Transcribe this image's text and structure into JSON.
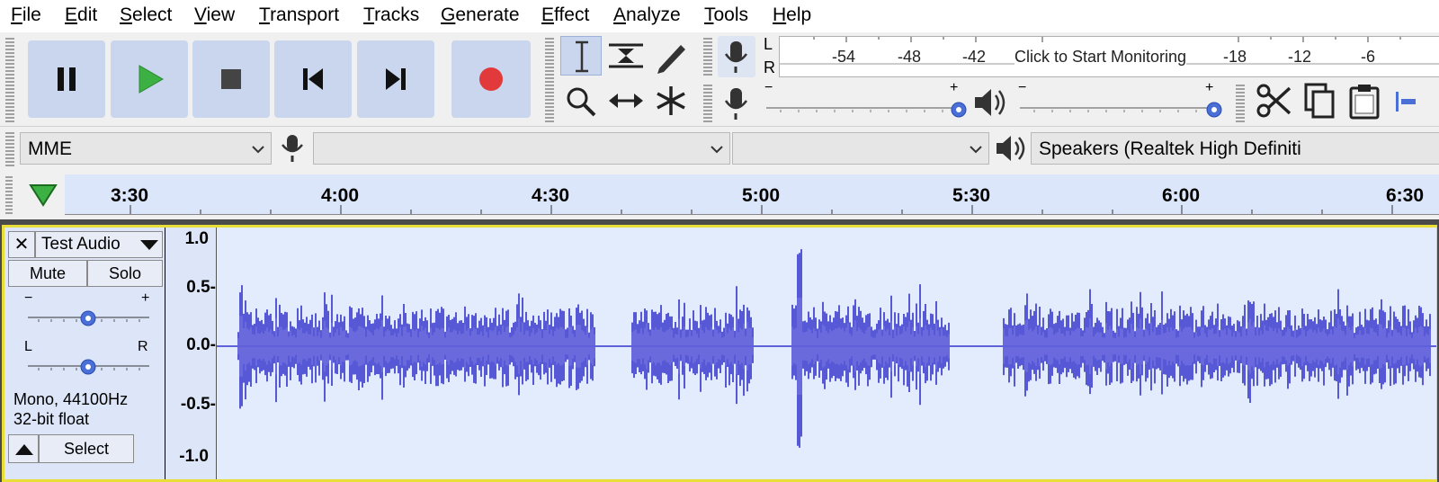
{
  "menu": [
    "File",
    "Edit",
    "Select",
    "View",
    "Transport",
    "Tracks",
    "Generate",
    "Effect",
    "Analyze",
    "Tools",
    "Help"
  ],
  "meter": {
    "lr_labels": [
      "L",
      "R"
    ],
    "ticks": [
      "-54",
      "-48",
      "-42",
      "-18",
      "-12",
      "-6"
    ],
    "prompt": "Click to Start Monitoring"
  },
  "mixer": {
    "minus": "−",
    "plus": "+"
  },
  "device": {
    "host": "MME",
    "recording_device": "",
    "recording_channels": "",
    "playback_device": "Speakers (Realtek High Definiti"
  },
  "timeline": {
    "labels": [
      "3:30",
      "4:00",
      "4:30",
      "5:00",
      "5:30",
      "6:00",
      "6:30"
    ]
  },
  "track": {
    "name": "Test Audio",
    "close": "✕",
    "mute": "Mute",
    "solo": "Solo",
    "gain_minus": "−",
    "gain_plus": "+",
    "pan_left": "L",
    "pan_right": "R",
    "info_line1": "Mono, 44100Hz",
    "info_line2": "32-bit float",
    "select": "Select",
    "amplitude_labels": [
      "1.0",
      "0.5-",
      "0.0-",
      "-0.5-",
      "-1.0"
    ]
  },
  "colors": {
    "waveform": "#3333cc",
    "waveform_rms": "#6666dd",
    "track_border": "#e9dd38",
    "play": "#3cb043",
    "record": "#e23a3a"
  }
}
